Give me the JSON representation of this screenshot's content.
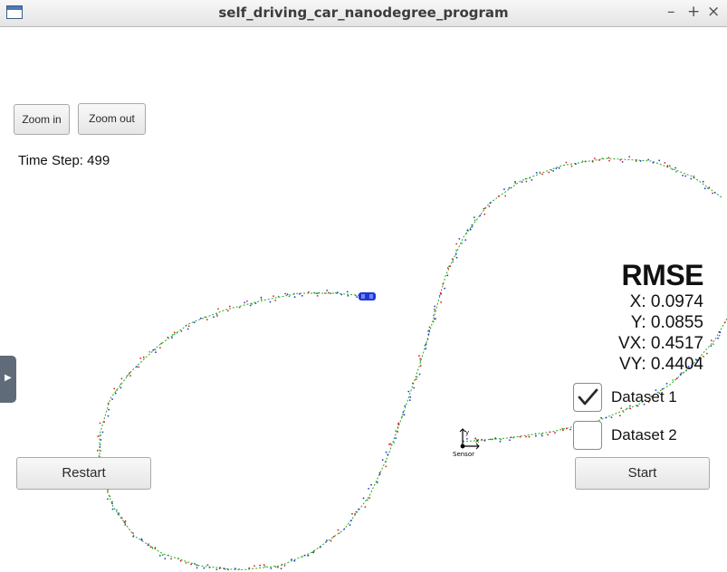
{
  "window": {
    "title": "self_driving_car_nanodegree_program",
    "controls": {
      "minimize": "–",
      "maximize": "+",
      "close": "×"
    }
  },
  "toolbar": {
    "zoom_in": "Zoom in",
    "zoom_out": "Zoom out"
  },
  "status": {
    "time_step": "Time Step: 499"
  },
  "rmse": {
    "title": "RMSE",
    "x": "X: 0.0974",
    "y": "Y: 0.0855",
    "vx": "VX: 0.4517",
    "vy": "VY: 0.4404"
  },
  "datasets": [
    {
      "label": "Dataset 1",
      "checked": true
    },
    {
      "label": "Dataset 2",
      "checked": false
    }
  ],
  "buttons": {
    "restart": "Restart",
    "start": "Start"
  },
  "sensor": {
    "label": "Sensor",
    "axis_x": "x",
    "axis_y": "y"
  },
  "colors": {
    "path": "#22aa22",
    "lidar": "#e0182a",
    "radar": "#2233dd",
    "estimate": "#1a9a1a",
    "car": "#1f35d8"
  },
  "icons": [
    "app-window-icon",
    "checkmark-icon",
    "sensor-axes-icon",
    "car-icon",
    "expand-handle-icon"
  ]
}
